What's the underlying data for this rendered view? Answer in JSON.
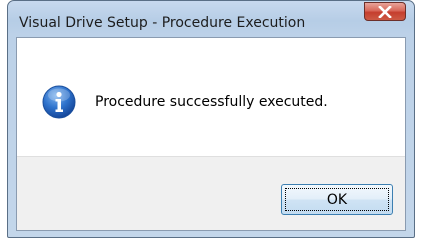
{
  "window": {
    "title": "Visual Drive Setup  -  Procedure Execution",
    "close_label": "Close"
  },
  "dialog": {
    "icon": "information-icon",
    "message": "Procedure successfully executed.",
    "ok_label": "OK"
  },
  "colors": {
    "frame": "#c3d6ea",
    "close_button": "#c53e2e",
    "info_icon": "#1d62b8",
    "footer": "#f0f0f0",
    "ok_border": "#3c7fb1"
  }
}
